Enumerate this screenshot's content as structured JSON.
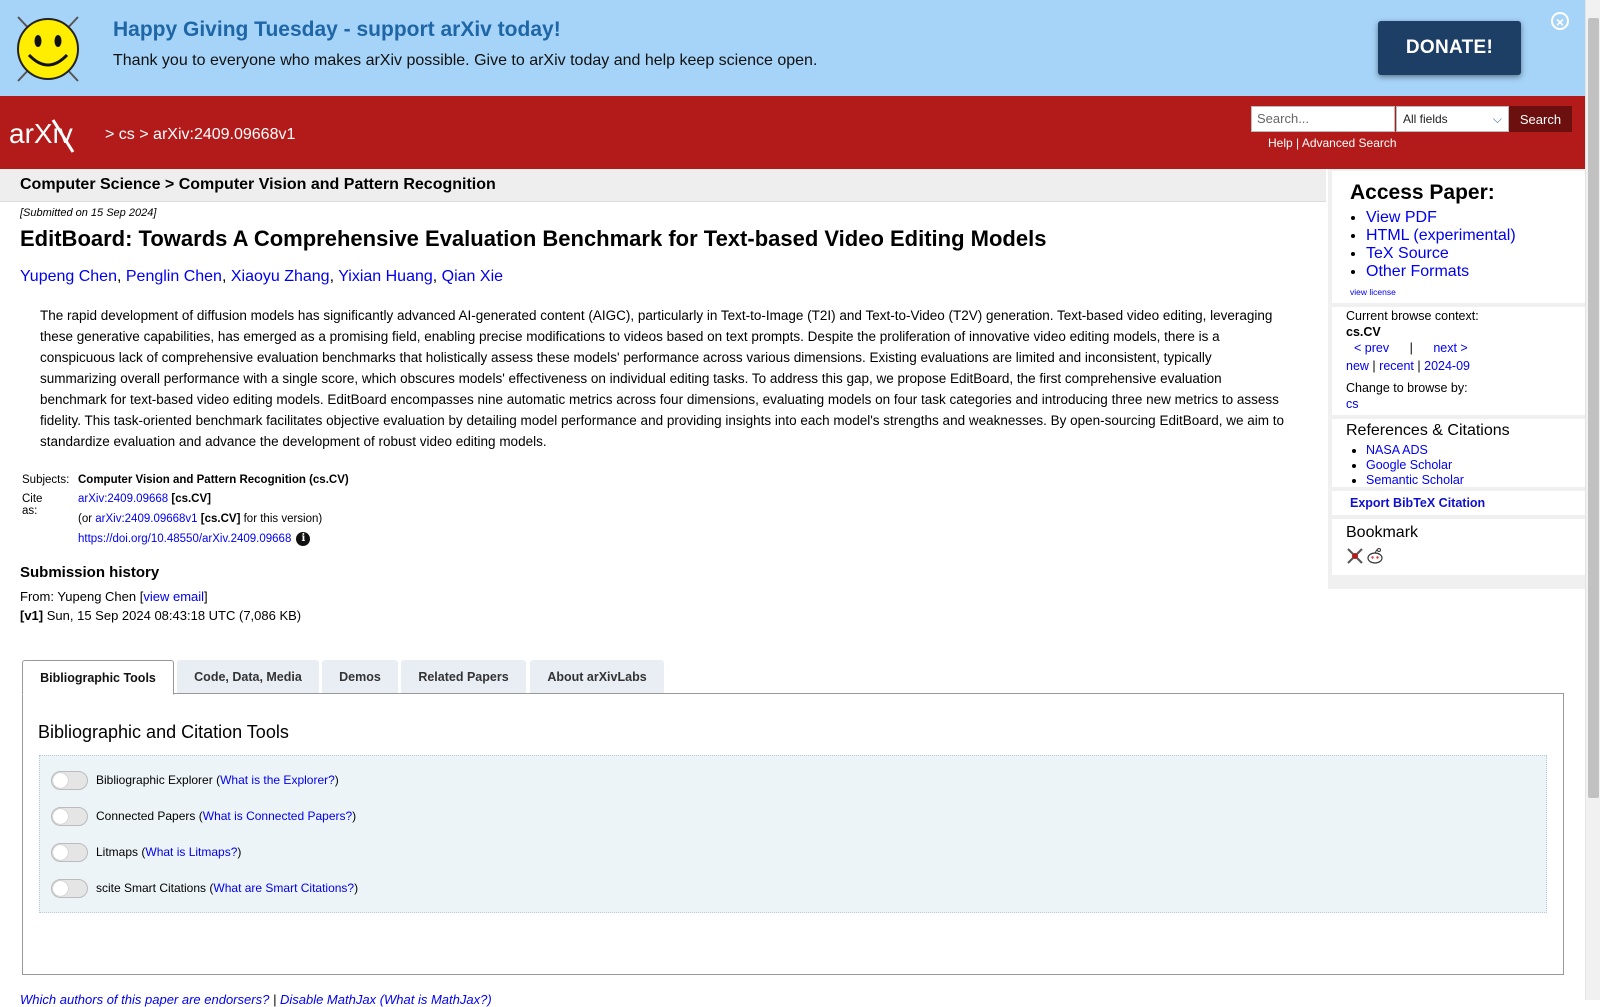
{
  "banner": {
    "title": "Happy Giving Tuesday - support arXiv today!",
    "text": "Thank you to everyone who makes arXiv possible. Give to arXiv today and help keep science open.",
    "donate_label": "DONATE!"
  },
  "header": {
    "logo_text": "arXiv",
    "crumb_sep1": ">",
    "crumb_cs": "cs",
    "crumb_sep2": ">",
    "crumb_id": "arXiv:2409.09668v1",
    "search_placeholder": "Search...",
    "search_field": "All fields",
    "search_button": "Search",
    "help_label": "Help",
    "links_sep": "|",
    "advanced_label": "Advanced Search"
  },
  "subject_bar": "Computer Science > Computer Vision and Pattern Recognition",
  "paper": {
    "submitted": "[Submitted on 15 Sep 2024]",
    "title": "EditBoard: Towards A Comprehensive Evaluation Benchmark for Text-based Video Editing Models",
    "authors": [
      "Yupeng Chen",
      "Penglin Chen",
      "Xiaoyu Zhang",
      "Yixian Huang",
      "Qian Xie"
    ],
    "abstract": "The rapid development of diffusion models has significantly advanced AI-generated content (AIGC), particularly in Text-to-Image (T2I) and Text-to-Video (T2V) generation. Text-based video editing, leveraging these generative capabilities, has emerged as a promising field, enabling precise modifications to videos based on text prompts. Despite the proliferation of innovative video editing models, there is a conspicuous lack of comprehensive evaluation benchmarks that holistically assess these models' performance across various dimensions. Existing evaluations are limited and inconsistent, typically summarizing overall performance with a single score, which obscures models' effectiveness on individual editing tasks. To address this gap, we propose EditBoard, the first comprehensive evaluation benchmark for text-based video editing models. EditBoard encompasses nine automatic metrics across four dimensions, evaluating models on four task categories and introducing three new metrics to assess fidelity. This task-oriented benchmark facilitates objective evaluation by detailing model performance and providing insights into each model's strengths and weaknesses. By open-sourcing EditBoard, we aim to standardize evaluation and advance the development of robust video editing models.",
    "subjects_label": "Subjects:",
    "subjects_value": "Computer Vision and Pattern Recognition (cs.CV)",
    "cite_label": "Cite as:",
    "cite_id": "arXiv:2409.09668",
    "cite_cat": "[cs.CV]",
    "cite_or": "(or",
    "cite_v1": "arXiv:2409.09668v1",
    "cite_v1_cat": "[cs.CV]",
    "cite_for": "for this version)",
    "doi": "https://doi.org/10.48550/arXiv.2409.09668",
    "history_heading": "Submission history",
    "from_prefix": "From: Yupeng Chen [",
    "view_email": "view email",
    "from_suffix": "]",
    "v1_label": "[v1]",
    "v1_text": "Sun, 15 Sep 2024 08:43:18 UTC (7,086 KB)"
  },
  "sidebar": {
    "access_title": "Access Paper:",
    "access_links": [
      "View PDF",
      "HTML (experimental)",
      "TeX Source",
      "Other Formats"
    ],
    "view_license": "view license",
    "context_label": "Current browse context:",
    "context_value": "cs.CV",
    "prev": "< prev",
    "pipe": "|",
    "next": "next >",
    "new": "new",
    "recent": "recent",
    "month": "2024-09",
    "change_label": "Change to browse by:",
    "change_value": "cs",
    "refs_title": "References & Citations",
    "refs_links": [
      "NASA ADS",
      "Google Scholar",
      "Semantic Scholar"
    ],
    "export_bibtex": "Export BibTeX Citation",
    "bookmark_title": "Bookmark"
  },
  "tabs": [
    "Bibliographic Tools",
    "Code, Data, Media",
    "Demos",
    "Related Papers",
    "About arXivLabs"
  ],
  "tools": {
    "title": "Bibliographic and Citation Tools",
    "rows": [
      {
        "label": "Bibliographic Explorer",
        "link": "What is the Explorer?"
      },
      {
        "label": "Connected Papers",
        "link": "What is Connected Papers?"
      },
      {
        "label": "Litmaps",
        "link": "What is Litmaps?"
      },
      {
        "label": "scite Smart Citations",
        "link": "What are Smart Citations?"
      }
    ]
  },
  "footer": {
    "endorsers": "Which authors of this paper are endorsers?",
    "sep": "|",
    "mathjax": "Disable MathJax",
    "what_mathjax": "(What is MathJax?)"
  },
  "colors": {
    "banner_bg": "#a6d3f8",
    "header_red": "#b31b1b",
    "donate_bg": "#1d3f66",
    "link_blue": "#0000ee"
  }
}
